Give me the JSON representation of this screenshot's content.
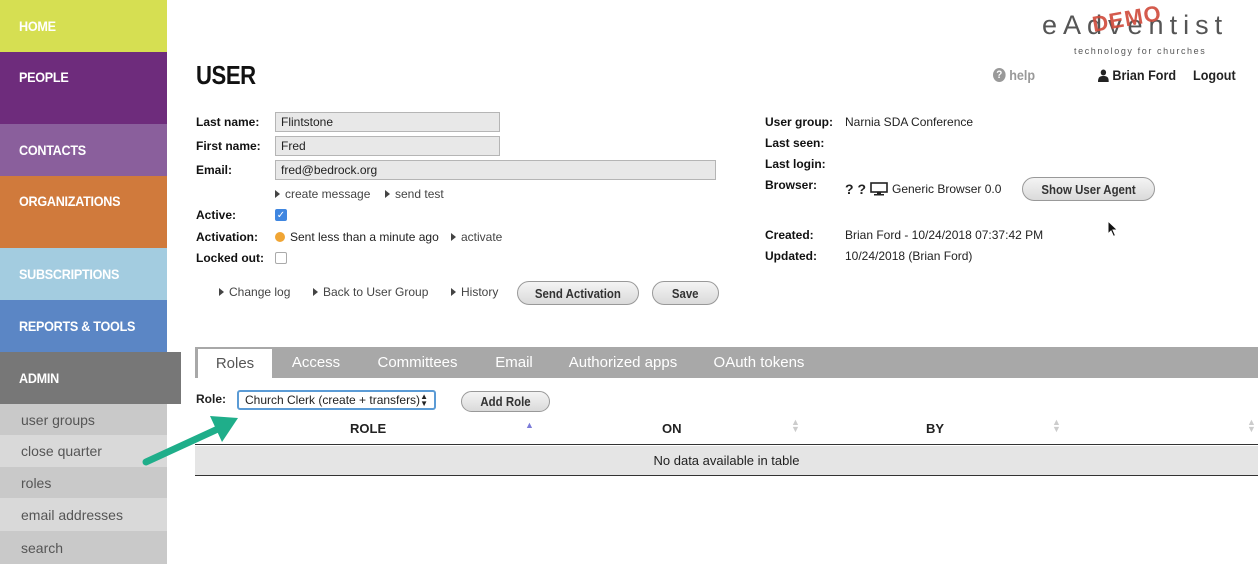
{
  "logo": {
    "main": "eAdventist",
    "demo": "DEMO",
    "tagline": "technology for churches"
  },
  "nav": {
    "items": [
      {
        "label": "HOME",
        "color": "#d6df52"
      },
      {
        "label": "PEOPLE",
        "color": "#6e2c7c"
      },
      {
        "label": "CONTACTS",
        "color": "#8a5f9c"
      },
      {
        "label": "ORGANIZATIONS",
        "color": "#d07a3c"
      },
      {
        "label": "SUBSCRIPTIONS",
        "color": "#a3cce0"
      },
      {
        "label": "REPORTS & TOOLS",
        "color": "#5b86c5"
      },
      {
        "label": "ADMIN",
        "color": "#777777"
      }
    ],
    "admin_sub": [
      "user groups",
      "close quarter",
      "roles",
      "email addresses",
      "search"
    ]
  },
  "header": {
    "title": "USER",
    "help": "help",
    "user": "Brian Ford",
    "logout": "Logout"
  },
  "form": {
    "last_name_label": "Last name:",
    "last_name": "Flintstone",
    "first_name_label": "First name:",
    "first_name": "Fred",
    "email_label": "Email:",
    "email": "fred@bedrock.org",
    "create_message": "create message",
    "send_test": "send test",
    "active_label": "Active:",
    "activation_label": "Activation:",
    "activation_status": "Sent less than a minute ago",
    "activate": "activate",
    "locked_label": "Locked out:",
    "change_log": "Change log",
    "back_to_group": "Back to User Group",
    "history": "History",
    "send_activation": "Send Activation",
    "save": "Save"
  },
  "info": {
    "user_group_label": "User group:",
    "user_group": "Narnia SDA Conference",
    "last_seen_label": "Last seen:",
    "last_login_label": "Last login:",
    "browser_label": "Browser:",
    "browser_icons": "? ?",
    "browser": "Generic Browser 0.0",
    "show_agent": "Show User Agent",
    "created_label": "Created:",
    "created": "Brian Ford - 10/24/2018 07:37:42 PM",
    "updated_label": "Updated:",
    "updated": "10/24/2018 (Brian Ford)"
  },
  "tabs": [
    "Roles",
    "Access",
    "Committees",
    "Email",
    "Authorized apps",
    "OAuth tokens"
  ],
  "roles": {
    "label": "Role:",
    "selected": "Church Clerk (create + transfers)",
    "add": "Add Role",
    "columns": [
      "ROLE",
      "ON",
      "BY"
    ],
    "empty": "No data available in table"
  },
  "colors": {
    "arrow": "#1fae8a"
  }
}
